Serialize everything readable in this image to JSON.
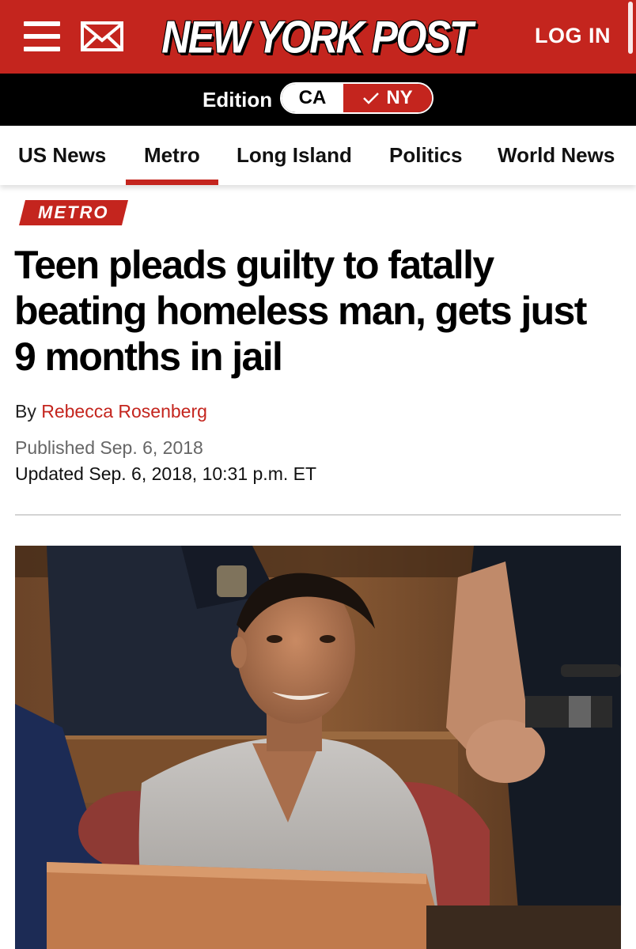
{
  "header": {
    "logo": "NEW YORK POST",
    "login_label": "LOG IN",
    "menu_icon": "hamburger-menu-icon",
    "mail_icon": "envelope-icon",
    "brand_red": "#c4251e"
  },
  "edition": {
    "label": "Edition",
    "options": [
      "CA",
      "NY"
    ],
    "selected": "NY"
  },
  "sections": {
    "items": [
      "US News",
      "Metro",
      "Long Island",
      "Politics",
      "World News"
    ],
    "active": "Metro"
  },
  "article": {
    "tag": "METRO",
    "headline": "Teen pleads guilty to fatally beating homeless man, gets just 9 months in jail",
    "byline_prefix": "By",
    "author": "Rebecca Rosenberg",
    "published": "Published Sep. 6, 2018",
    "updated": "Updated Sep. 6, 2018, 10:31 p.m. ET"
  }
}
